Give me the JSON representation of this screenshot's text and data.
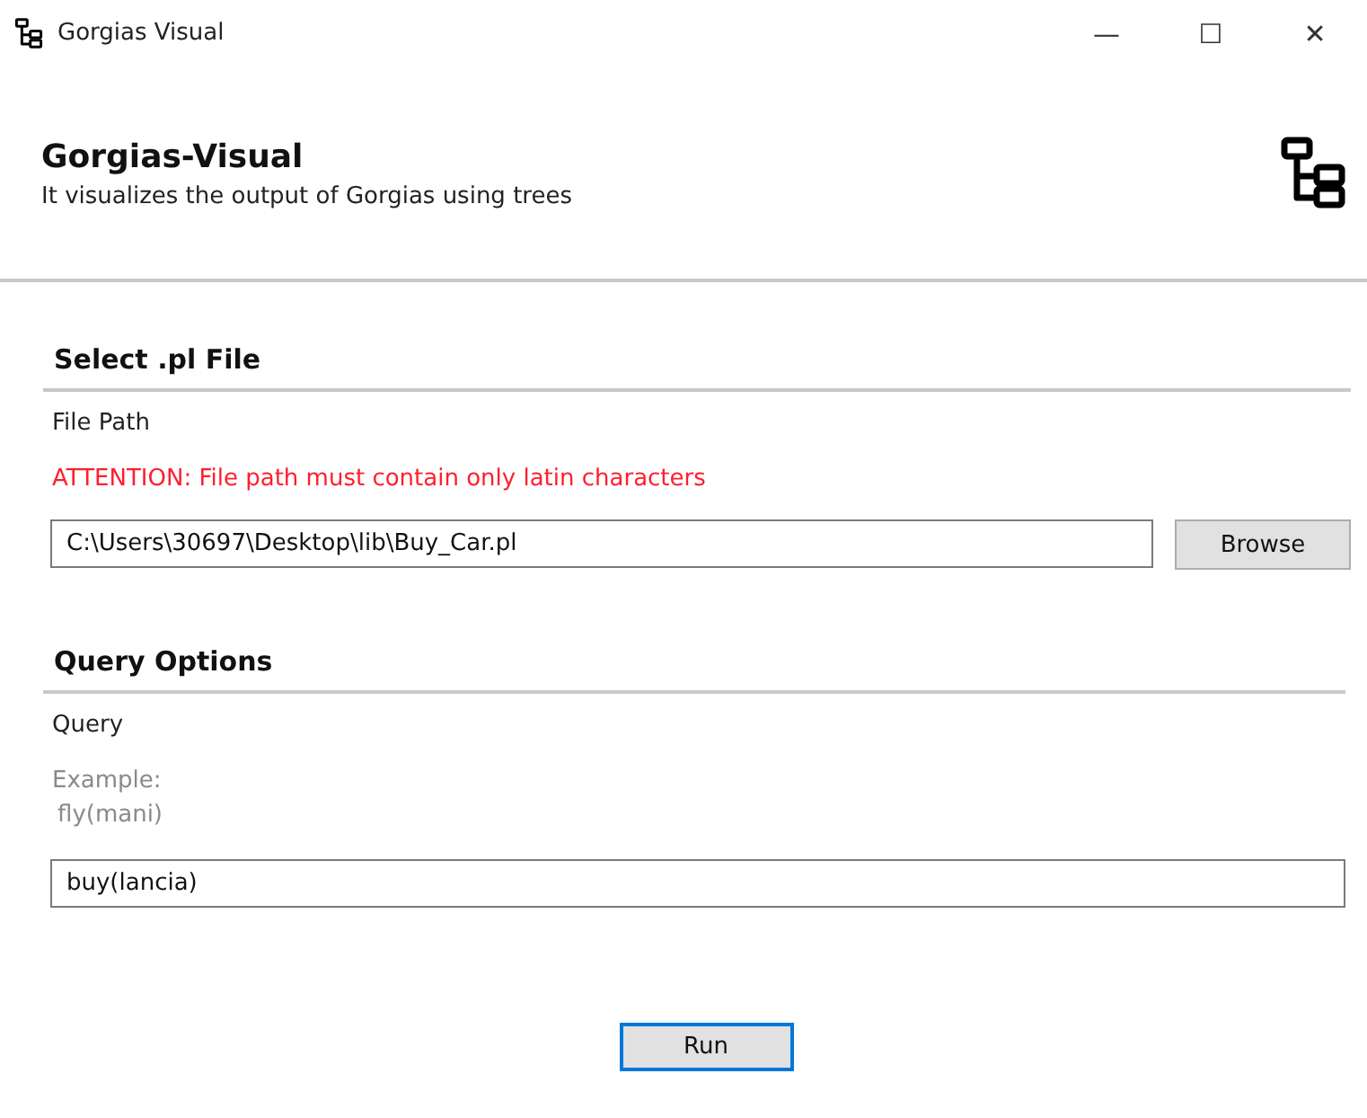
{
  "window": {
    "title": "Gorgias Visual",
    "controls": [
      "—",
      "☐",
      "✕"
    ]
  },
  "header": {
    "title": "Gorgias-Visual",
    "subtitle": "It visualizes the output of Gorgias using trees"
  },
  "file_section": {
    "title": "Select .pl File",
    "label": "File Path",
    "warning": "ATTENTION: File path must contain only latin characters",
    "value": "C:\\Users\\30697\\Desktop\\lib\\Buy_Car.pl",
    "button": "Browse"
  },
  "query_section": {
    "title": "Query Options",
    "label": "Query",
    "hint_lines": [
      "Example:",
      "fly(mani)"
    ],
    "value": "buy(lancia)"
  },
  "run_button": "Run"
}
